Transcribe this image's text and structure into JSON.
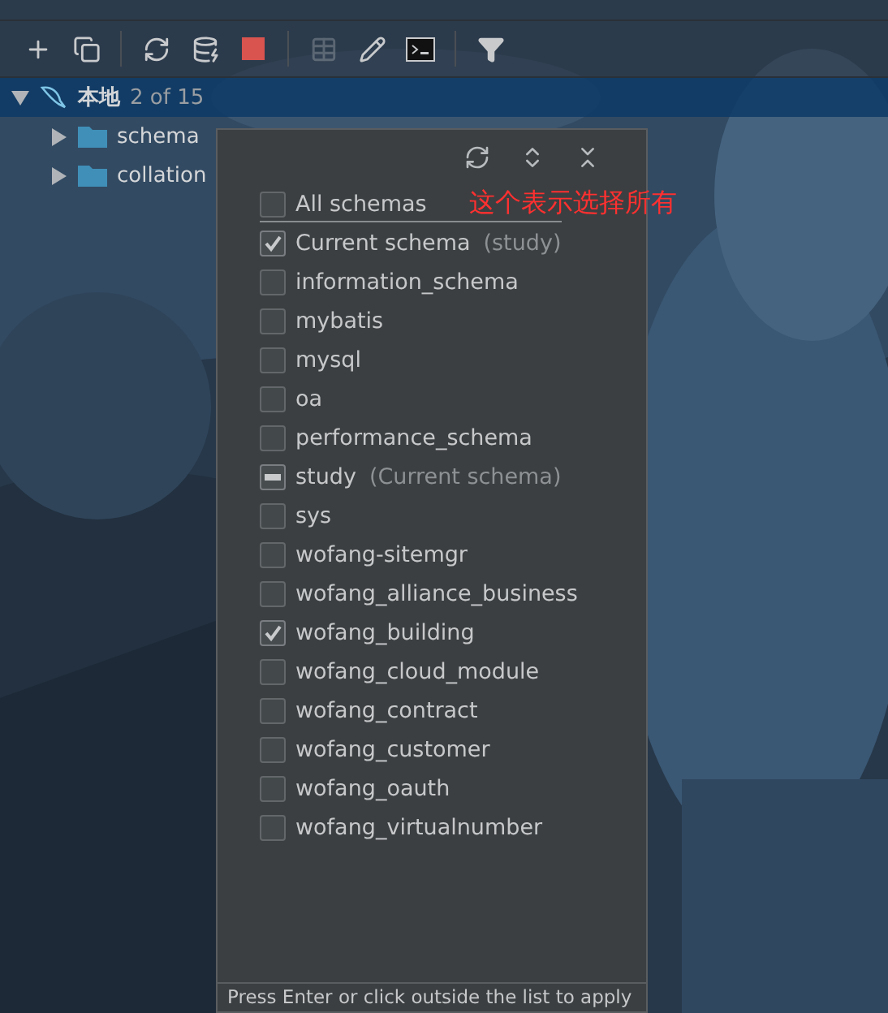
{
  "toolbar": {
    "buttons": [
      {
        "kind": "add",
        "disabled": false
      },
      {
        "kind": "copy",
        "disabled": false
      },
      {
        "kind": "refresh",
        "disabled": false
      },
      {
        "kind": "properties",
        "disabled": false
      },
      {
        "kind": "stop",
        "disabled": false
      },
      {
        "kind": "table",
        "disabled": true
      },
      {
        "kind": "edit",
        "disabled": false
      },
      {
        "kind": "console",
        "disabled": false
      },
      {
        "kind": "filter",
        "disabled": false
      }
    ]
  },
  "tree": {
    "label": "本地",
    "count": "2 of 15",
    "expanded": true,
    "selected": true,
    "children": [
      {
        "label": "schema",
        "expanded": false
      },
      {
        "label": "collation",
        "expanded": false
      }
    ]
  },
  "popup": {
    "header_buttons": [
      {
        "kind": "refresh"
      },
      {
        "kind": "expand"
      },
      {
        "kind": "collapse"
      }
    ],
    "items": [
      {
        "label": "All schemas",
        "checked": false,
        "mixed": false
      },
      {
        "label": "Current schema",
        "note": "(study)",
        "checked": true,
        "mixed": false
      },
      {
        "label": "information_schema",
        "checked": false,
        "mixed": false
      },
      {
        "label": "mybatis",
        "checked": false,
        "mixed": false
      },
      {
        "label": "mysql",
        "checked": false,
        "mixed": false
      },
      {
        "label": "oa",
        "checked": false,
        "mixed": false
      },
      {
        "label": "performance_schema",
        "checked": false,
        "mixed": false
      },
      {
        "label": "study",
        "note": "(Current schema)",
        "checked": true,
        "mixed": true
      },
      {
        "label": "sys",
        "checked": false,
        "mixed": false
      },
      {
        "label": "wofang-sitemgr",
        "checked": false,
        "mixed": false
      },
      {
        "label": "wofang_alliance_business",
        "checked": false,
        "mixed": false
      },
      {
        "label": "wofang_building",
        "checked": true,
        "mixed": false
      },
      {
        "label": "wofang_cloud_module",
        "checked": false,
        "mixed": false
      },
      {
        "label": "wofang_contract",
        "checked": false,
        "mixed": false
      },
      {
        "label": "wofang_customer",
        "checked": false,
        "mixed": false
      },
      {
        "label": "wofang_oauth",
        "checked": false,
        "mixed": false
      },
      {
        "label": "wofang_virtualnumber",
        "checked": false,
        "mixed": false
      }
    ],
    "footer": "Press Enter or click outside the list to apply"
  },
  "annotation": "这个表示选择所有"
}
